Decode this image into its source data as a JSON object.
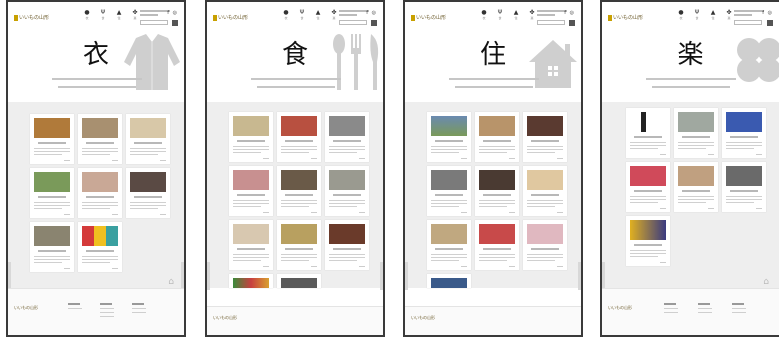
{
  "site": {
    "logo_text": "いいもの山形",
    "nav": [
      {
        "glyph": "衣",
        "icon": "shirt-icon"
      },
      {
        "glyph": "食",
        "icon": "fork-knife-icon"
      },
      {
        "glyph": "住",
        "icon": "house-icon"
      },
      {
        "glyph": "楽",
        "icon": "clover-icon"
      }
    ],
    "social": "f ◎"
  },
  "pages": [
    {
      "kanji": "衣",
      "deco_icon": "cardigan-icon",
      "cards": 8
    },
    {
      "kanji": "食",
      "deco_icon": "spoon-fork-icon",
      "cards": 11
    },
    {
      "kanji": "住",
      "deco_icon": "house-icon",
      "cards": 10
    },
    {
      "kanji": "楽",
      "deco_icon": "clover-icon",
      "cards": 7
    }
  ],
  "footer": {
    "to_top_glyph": "⌂"
  },
  "colors": {
    "accent": "#c8a000",
    "section_bg": "#eeeeee",
    "frame": "#3a3a3a"
  }
}
